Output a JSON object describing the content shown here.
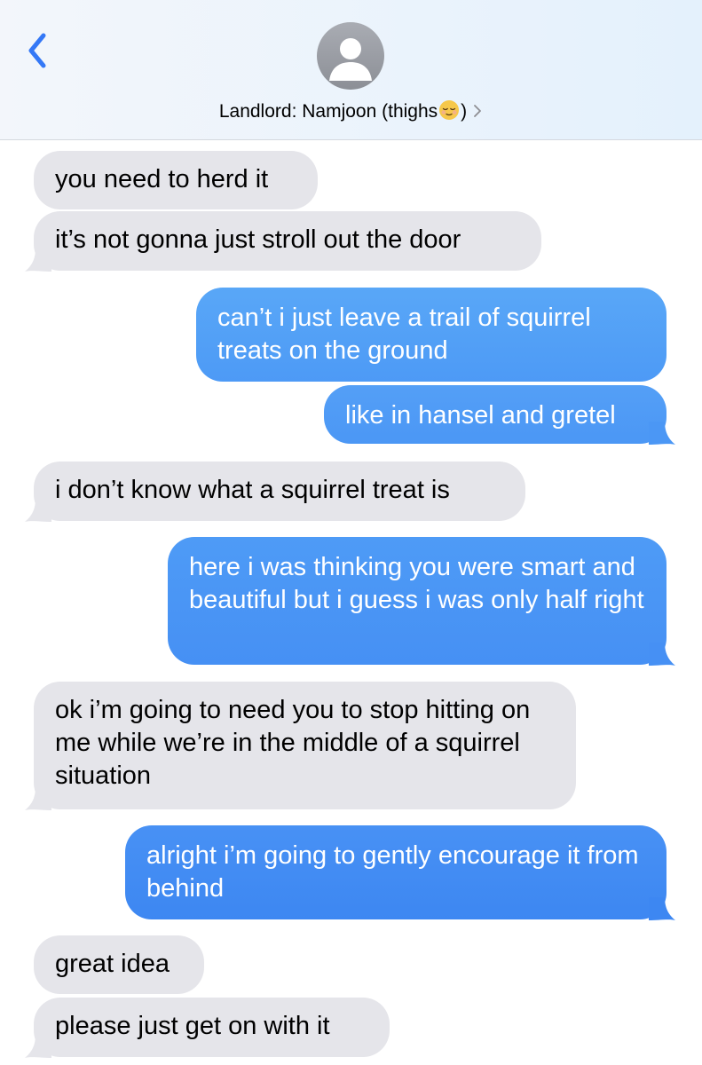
{
  "header": {
    "contact_prefix": "Landlord: Namjoon (thighs",
    "contact_suffix": ")",
    "back_icon": "chevron-left-icon",
    "avatar_icon": "person-silhouette-icon",
    "emoji_icon": "relieved-face-emoji",
    "accent_color": "#3478f6"
  },
  "messages": [
    {
      "direction": "received",
      "text": "you need to herd it"
    },
    {
      "direction": "received",
      "text": "it’s not gonna just stroll out the door"
    },
    {
      "direction": "sent",
      "text": "can’t i just leave a trail of squirrel treats on the ground"
    },
    {
      "direction": "sent",
      "text": "like in hansel and gretel"
    },
    {
      "direction": "received",
      "text": "i don’t know what a squirrel treat is"
    },
    {
      "direction": "sent",
      "text": "here i was thinking you were smart and beautiful but i guess i was only half right"
    },
    {
      "direction": "received",
      "text": "ok i’m going to need you to stop hitting on me while we’re in the middle of a squirrel situation"
    },
    {
      "direction": "sent",
      "text": "alright i’m going to gently encourage it from behind"
    },
    {
      "direction": "received",
      "text": "great idea"
    },
    {
      "direction": "received",
      "text": "please just get on with it"
    }
  ],
  "colors": {
    "received_bubble": "#e5e5ea",
    "sent_bubble_top": "#5aa9f8",
    "sent_bubble_bottom": "#3a86f3"
  }
}
